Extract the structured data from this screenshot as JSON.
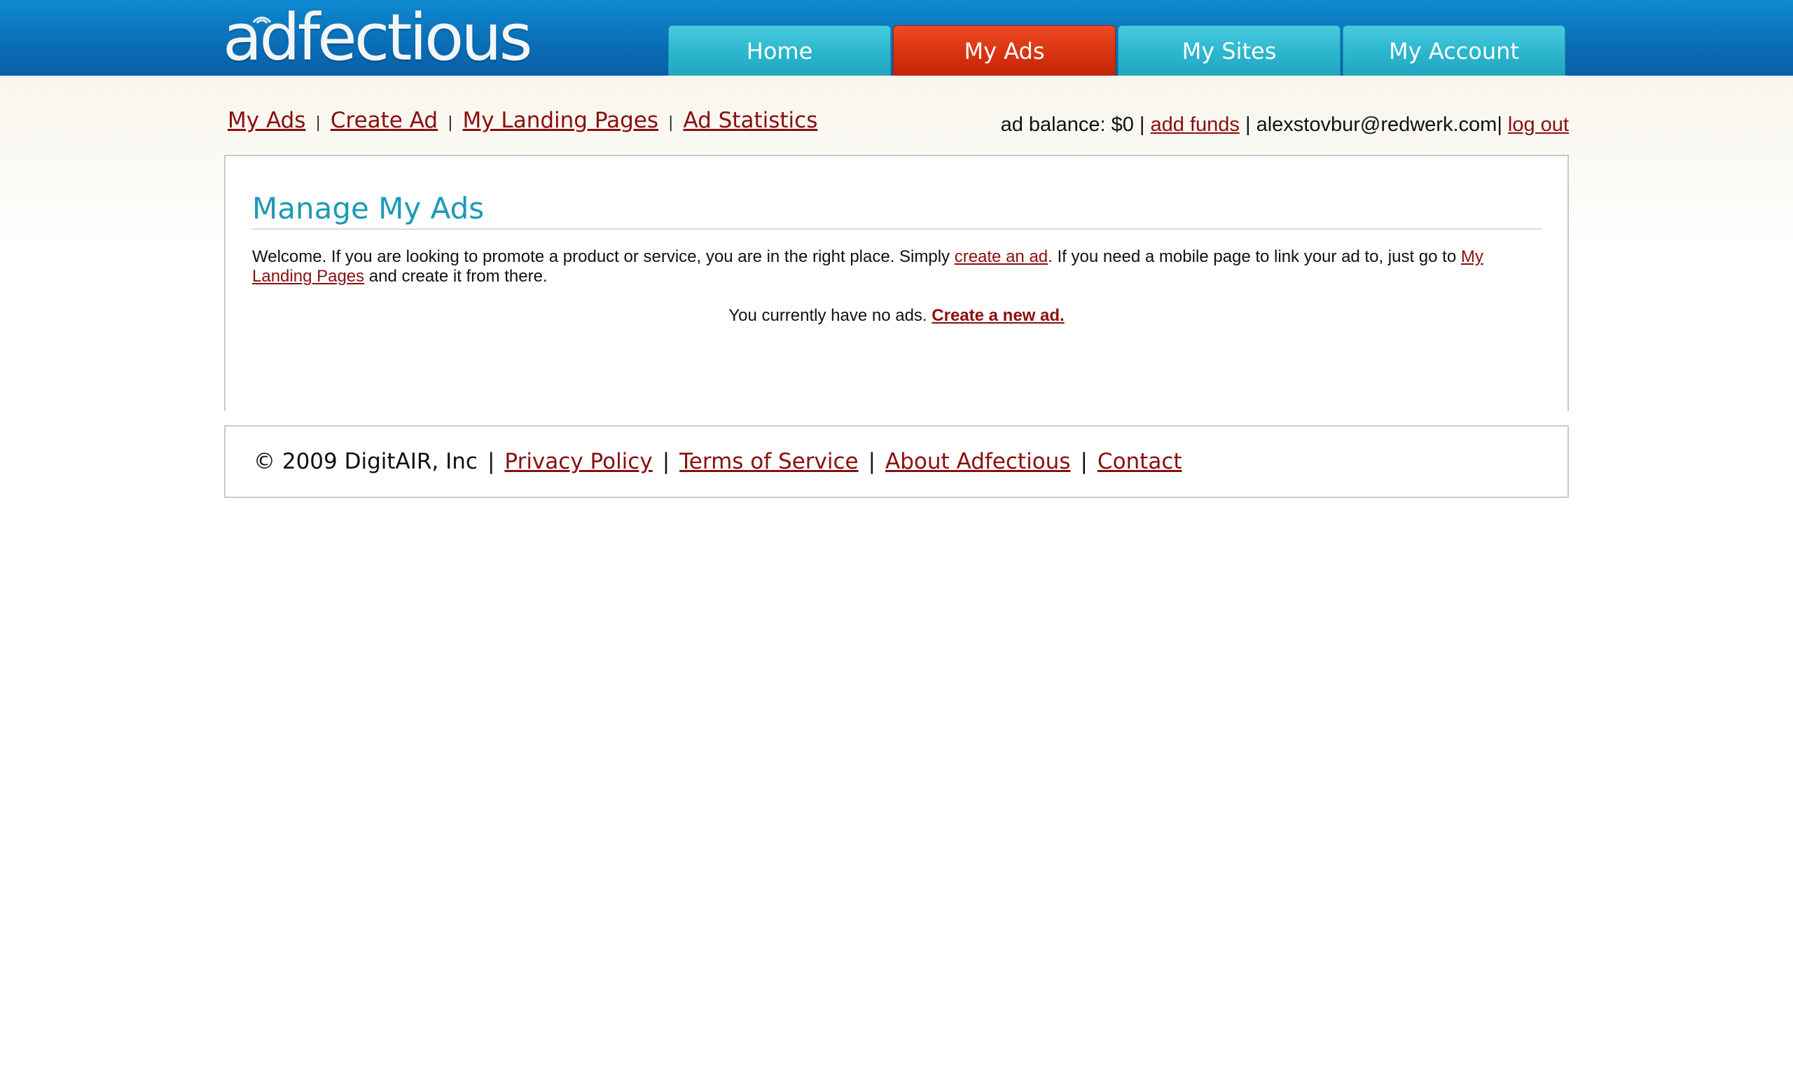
{
  "header": {
    "logo_text": "adfectious",
    "tabs": [
      {
        "label": "Home",
        "active": false
      },
      {
        "label": "My Ads",
        "active": true
      },
      {
        "label": "My Sites",
        "active": false
      },
      {
        "label": "My Account",
        "active": false
      }
    ]
  },
  "subnav": {
    "items": [
      {
        "label": "My Ads"
      },
      {
        "label": "Create Ad"
      },
      {
        "label": "My Landing Pages"
      },
      {
        "label": "Ad Statistics"
      }
    ],
    "separator": "|"
  },
  "account": {
    "balance_text": "ad balance: $0",
    "add_funds_label": "add funds",
    "email": "alexstovbur@redwerk.com",
    "logout_label": "log out",
    "separator": "|"
  },
  "main": {
    "title": "Manage My Ads",
    "intro_part1": "Welcome. If you are looking to promote a product or service, you are in the right place. Simply ",
    "intro_link1": "create an ad",
    "intro_part2": ". If you need a mobile page to link your ad to, just go to ",
    "intro_link2": "My Landing Pages",
    "intro_part3": " and create it from there.",
    "no_ads_text": "You currently have no ads. ",
    "create_new_label": "Create a new ad."
  },
  "footer": {
    "copyright": "© 2009 DigitAIR, Inc",
    "links": [
      {
        "label": "Privacy Policy"
      },
      {
        "label": "Terms of Service"
      },
      {
        "label": "About Adfectious"
      },
      {
        "label": "Contact"
      }
    ],
    "separator": "|"
  },
  "colors": {
    "header_blue": "#0a6fb8",
    "tab_teal": "#2eb7cf",
    "tab_active_red": "#d83312",
    "link_red": "#8a0f0f",
    "title_teal": "#1c9ab5"
  }
}
